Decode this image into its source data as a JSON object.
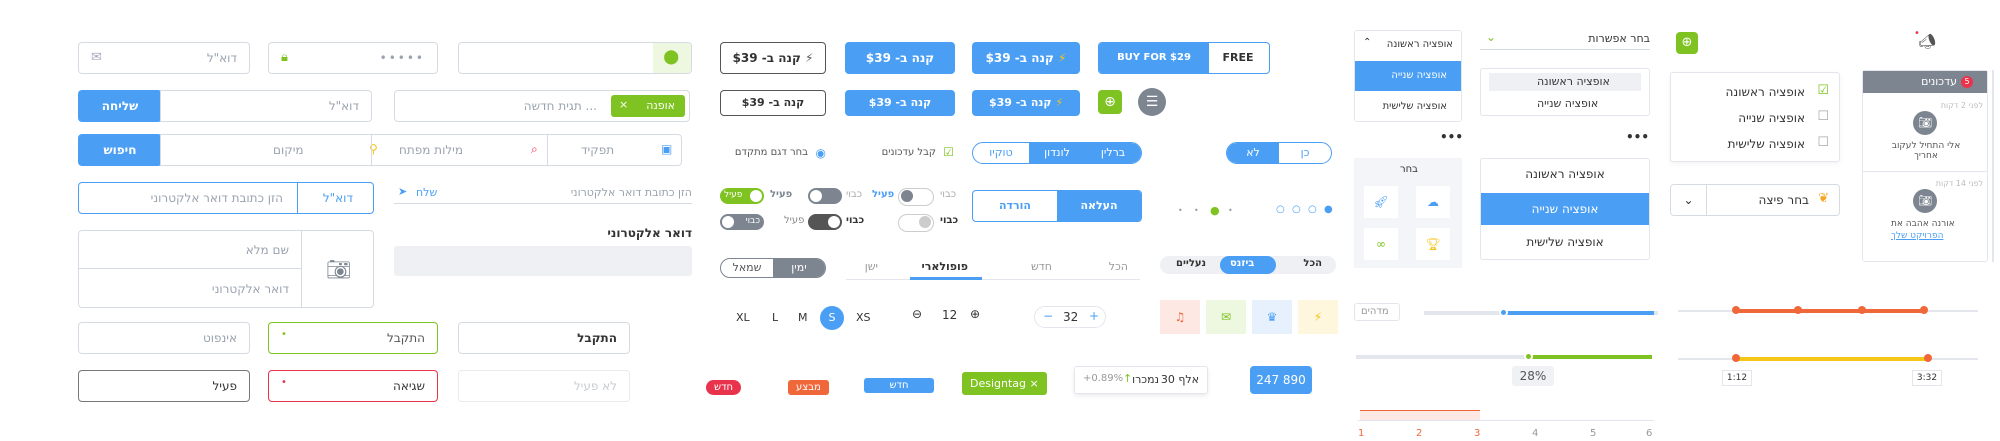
{
  "col1": {
    "email_ph": "דוא\"ל",
    "password_dots": "•••••",
    "email2_ph": "דוא\"ל",
    "send_btn": "שליחה",
    "search_btn": "חיפוש",
    "location_ph": "מיקום",
    "keywords_ph": "מילות מפתח",
    "role_ph": "תפקיד",
    "tag_label": "אופנה",
    "new_tag_ph": "תגית חדשה ...",
    "email_addr_ph": "הזן כתובת דואר אלקטרוני",
    "email_addr_btn": "דוא\"ל",
    "send_link": "שלח",
    "email_addr_ph2": "הזן כתובת דואר אלקטרוני",
    "fullname_ph": "שם מלא",
    "email_field_ph": "דואר אלקטרוני",
    "email_label": "דואר אלקטרוני",
    "info_ph": "אינפוט",
    "accepted_label": "התקבל",
    "accepted_bold": "התקבל",
    "active_label": "פעיל",
    "error_label": "שגיאה",
    "inactive_ph": "לא פעיל"
  },
  "col2": {
    "buy_outline": "קנה ב- $39",
    "buy_blue": "קנה ב- $39",
    "buy_blue_icon": "קנה ב- $39",
    "buy_for": "BUY FOR $29",
    "free": "FREE",
    "buy_outline_sm": "קנה ב- $39",
    "buy_blue_sm": "קנה ב- $39",
    "buy_blue_icon_sm": "קנה ב- $39",
    "radio_label": "בחר דגם מתקדם",
    "check_label": "קבל עדכונים",
    "cities": [
      "טוקיו",
      "לונדון",
      "ברלין"
    ],
    "yesno": [
      "לא",
      "כן"
    ],
    "upload": "העלאה",
    "download": "הורדה",
    "tog_labels": {
      "on": "פעיל",
      "off": "כבוי"
    },
    "tabs": [
      "הכל",
      "חדש",
      "פופולארי",
      "ישן"
    ],
    "chips": [
      "הכל",
      "ביזנס",
      "נעליים"
    ],
    "rightleft": [
      "ימין",
      "שמאל"
    ],
    "sizes": [
      "XL",
      "L",
      "M",
      "S",
      "XS"
    ],
    "stepper1": "12",
    "stepper2": "32",
    "tags": {
      "new": "חדש",
      "sale": "מבצע",
      "new2": "חדש",
      "designtag": "Designtag"
    },
    "stat_text": "30 אלף",
    "stat_pct": "+0.89%",
    "stat_views": "נמכרו",
    "bubble_val": "247 890"
  },
  "col3": {
    "dropdown1_head": "אופציה ראשונה",
    "dropdown1_items": [
      "אופציה שנייה",
      "אופציה שלישית"
    ],
    "select_label": "בחר אפשרות",
    "select_items": [
      "אופציה ראשונה",
      "אופציה שנייה"
    ],
    "choose": "בחר",
    "menu_items": [
      "אופציה ראשונה",
      "אופציה שנייה",
      "אופציה שלישית"
    ],
    "ms_label": "מדהים",
    "pct_label": "28%",
    "scale": [
      "1",
      "2",
      "3",
      "4",
      "5",
      "6"
    ]
  },
  "col4": {
    "checklist": [
      "אופציה ראשונה",
      "אופציה שנייה",
      "אופציה שלישית"
    ],
    "pizza": "בחר פיצה",
    "times": [
      "1:12",
      "3:32"
    ]
  },
  "col5": {
    "header": "עדכונים",
    "badge": "5",
    "note1_time": "לפני 2 דקות",
    "note1_text": "אלי התחיל לעקוב אחריך",
    "note2_time": "לפני 14 דקות",
    "note2_text": "אורנה אהבה את",
    "note2_link": "הפרויקט שלך"
  },
  "colors": {
    "blue": "#4a9ff5",
    "green": "#7ec321",
    "orange": "#f0673a",
    "yellow": "#f5c518",
    "red": "#e9334d",
    "gray": "#7c8590"
  }
}
